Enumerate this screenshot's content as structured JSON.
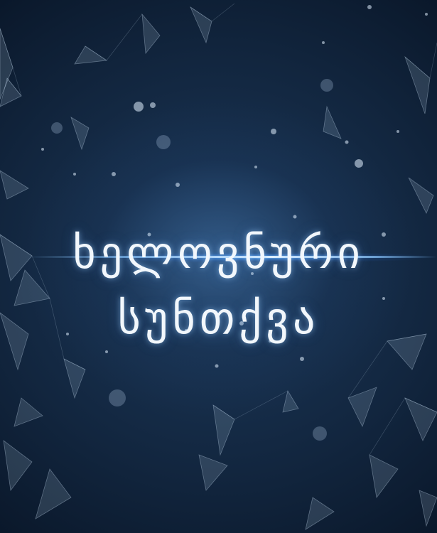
{
  "title": {
    "line1": "ხელოვნური",
    "line2": "სუნთქვა"
  },
  "colors": {
    "background": "#12263f",
    "glow": "#8cc8ff",
    "text": "#f2f7fc"
  }
}
